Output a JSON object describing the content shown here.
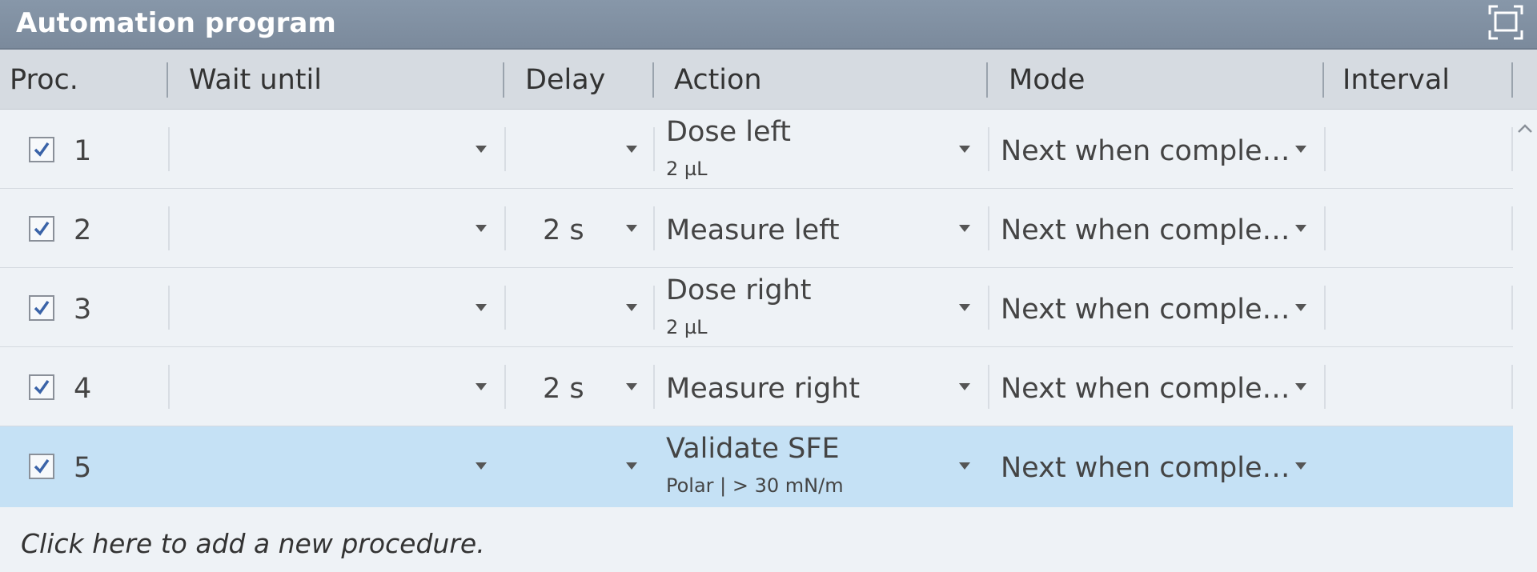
{
  "window": {
    "title": "Automation program"
  },
  "columns": {
    "proc": "Proc.",
    "wait_until": "Wait until",
    "delay": "Delay",
    "action": "Action",
    "mode": "Mode",
    "interval": "Interval"
  },
  "rows": [
    {
      "proc": "1",
      "checked": true,
      "wait_until": "",
      "delay": "",
      "action": "Dose left",
      "action_detail": "2 µL",
      "mode": "Next when comple…",
      "interval": ""
    },
    {
      "proc": "2",
      "checked": true,
      "wait_until": "",
      "delay": "2 s",
      "action": "Measure left",
      "action_detail": "",
      "mode": "Next when comple…",
      "interval": ""
    },
    {
      "proc": "3",
      "checked": true,
      "wait_until": "",
      "delay": "",
      "action": "Dose right",
      "action_detail": "2 µL",
      "mode": "Next when comple…",
      "interval": ""
    },
    {
      "proc": "4",
      "checked": true,
      "wait_until": "",
      "delay": "2 s",
      "action": "Measure right",
      "action_detail": "",
      "mode": "Next when comple…",
      "interval": ""
    },
    {
      "proc": "5",
      "checked": true,
      "wait_until": "",
      "delay": "",
      "action": "Validate SFE",
      "action_detail": "Polar | > 30 mN/m",
      "mode": "Next when comple…",
      "interval": "",
      "selected": true
    }
  ],
  "footer": {
    "add_procedure": "Click here to add a new procedure."
  },
  "colors": {
    "title_bar": "#7f8ea0",
    "header": "#d6dbe1",
    "row": "#eef2f6",
    "selected_row": "#c5e1f5"
  },
  "icons": [
    "maximize-icon",
    "checkbox-checked-icon",
    "dropdown-arrow-icon",
    "scroll-up-icon"
  ]
}
